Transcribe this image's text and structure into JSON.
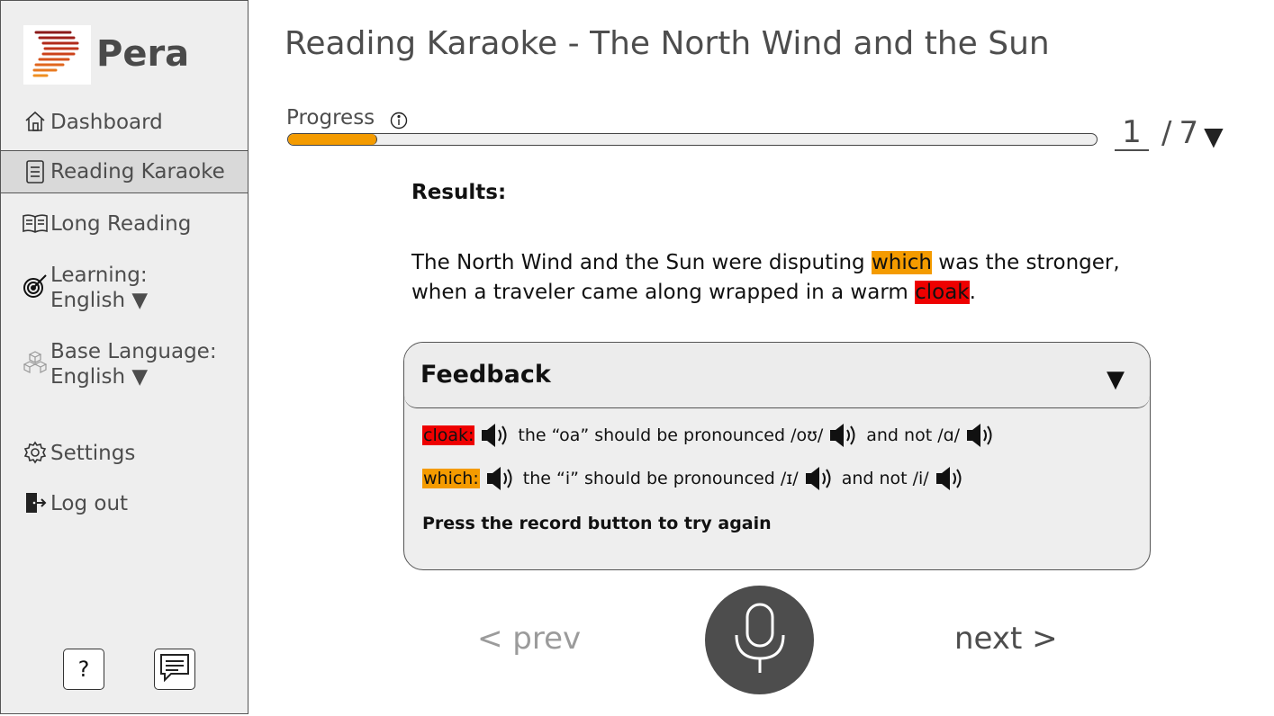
{
  "app": {
    "name": "Pera"
  },
  "sidebar": {
    "items": [
      {
        "label": "Dashboard",
        "icon": "home-icon"
      },
      {
        "label": "Reading Karaoke",
        "icon": "document-icon",
        "active": true
      },
      {
        "label": "Long Reading",
        "icon": "book-icon"
      },
      {
        "label": "Learning:",
        "label2": "English ▼",
        "icon": "target-icon"
      },
      {
        "label": "Base Language:",
        "label2": "English ▼",
        "icon": "cubes-icon"
      },
      {
        "label": "Settings",
        "icon": "gear-icon"
      },
      {
        "label": "Log out",
        "icon": "logout-icon"
      }
    ],
    "help_label": "?",
    "chat_icon": "chat-icon"
  },
  "page": {
    "title": "Reading Karaoke - The North Wind and the Sun"
  },
  "progress": {
    "label": "Progress",
    "fraction": 0.11,
    "current": "1",
    "separator": "/",
    "total": "7",
    "caret": "▼"
  },
  "results": {
    "title": "Results:",
    "line1_a": "The North Wind and the Sun were disputing ",
    "line1_hl": "which",
    "line1_b": " was the stronger,",
    "line2_a": "when a traveler came along wrapped in a warm ",
    "line2_hl": "cloak",
    "line2_b": "."
  },
  "feedback": {
    "title": "Feedback",
    "caret": "▼",
    "rows": [
      {
        "word": "cloak:",
        "color": "#ee0000",
        "text1": "the “oa” should be pronounced /oʊ/",
        "text2": "and not /ɑ/"
      },
      {
        "word": "which:",
        "color": "#f49b00",
        "text1": "the “i” should be pronounced /ɪ/",
        "text2": "and not /i/"
      }
    ],
    "note": "Press the record button to try again"
  },
  "nav": {
    "prev": "< prev",
    "next": "next >"
  },
  "colors": {
    "accent_orange": "#f49b00",
    "error_red": "#ee0000",
    "mic_bg": "#4d4d4d"
  }
}
